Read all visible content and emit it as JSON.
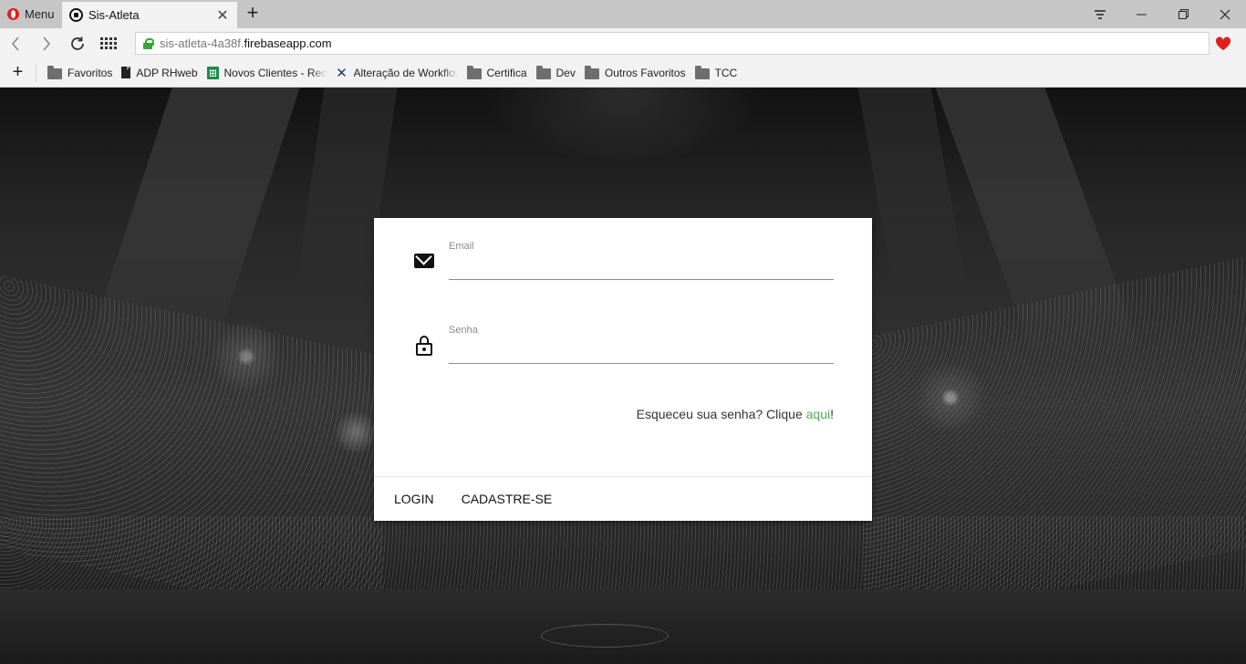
{
  "browser": {
    "menu_label": "Menu",
    "tab_title": "Sis-Atleta",
    "url_host": "sis-atleta-4a38f.",
    "url_domain": "firebaseapp.com",
    "bookmarks": [
      {
        "label": "Favoritos",
        "icon": "folder-icon"
      },
      {
        "label": "ADP RHweb",
        "icon": "document-icon"
      },
      {
        "label": "Novos Clientes - Rede",
        "icon": "spreadsheet-icon"
      },
      {
        "label": "Alteração de Workflow",
        "icon": "x-logo-icon"
      },
      {
        "label": "Certifica",
        "icon": "folder-icon"
      },
      {
        "label": "Dev",
        "icon": "folder-icon"
      },
      {
        "label": "Outros Favoritos",
        "icon": "folder-icon"
      },
      {
        "label": "TCC",
        "icon": "folder-icon"
      }
    ]
  },
  "login": {
    "email_label": "Email",
    "email_value": "",
    "password_label": "Senha",
    "password_value": "",
    "forgot_text": "Esqueceu sua senha? Clique ",
    "forgot_link": "aqui",
    "forgot_suffix": "!",
    "login_button": "LOGIN",
    "signup_button": "CADASTRE-SE"
  },
  "colors": {
    "accent_link": "#4caf50",
    "opera_red": "#e0201b"
  }
}
